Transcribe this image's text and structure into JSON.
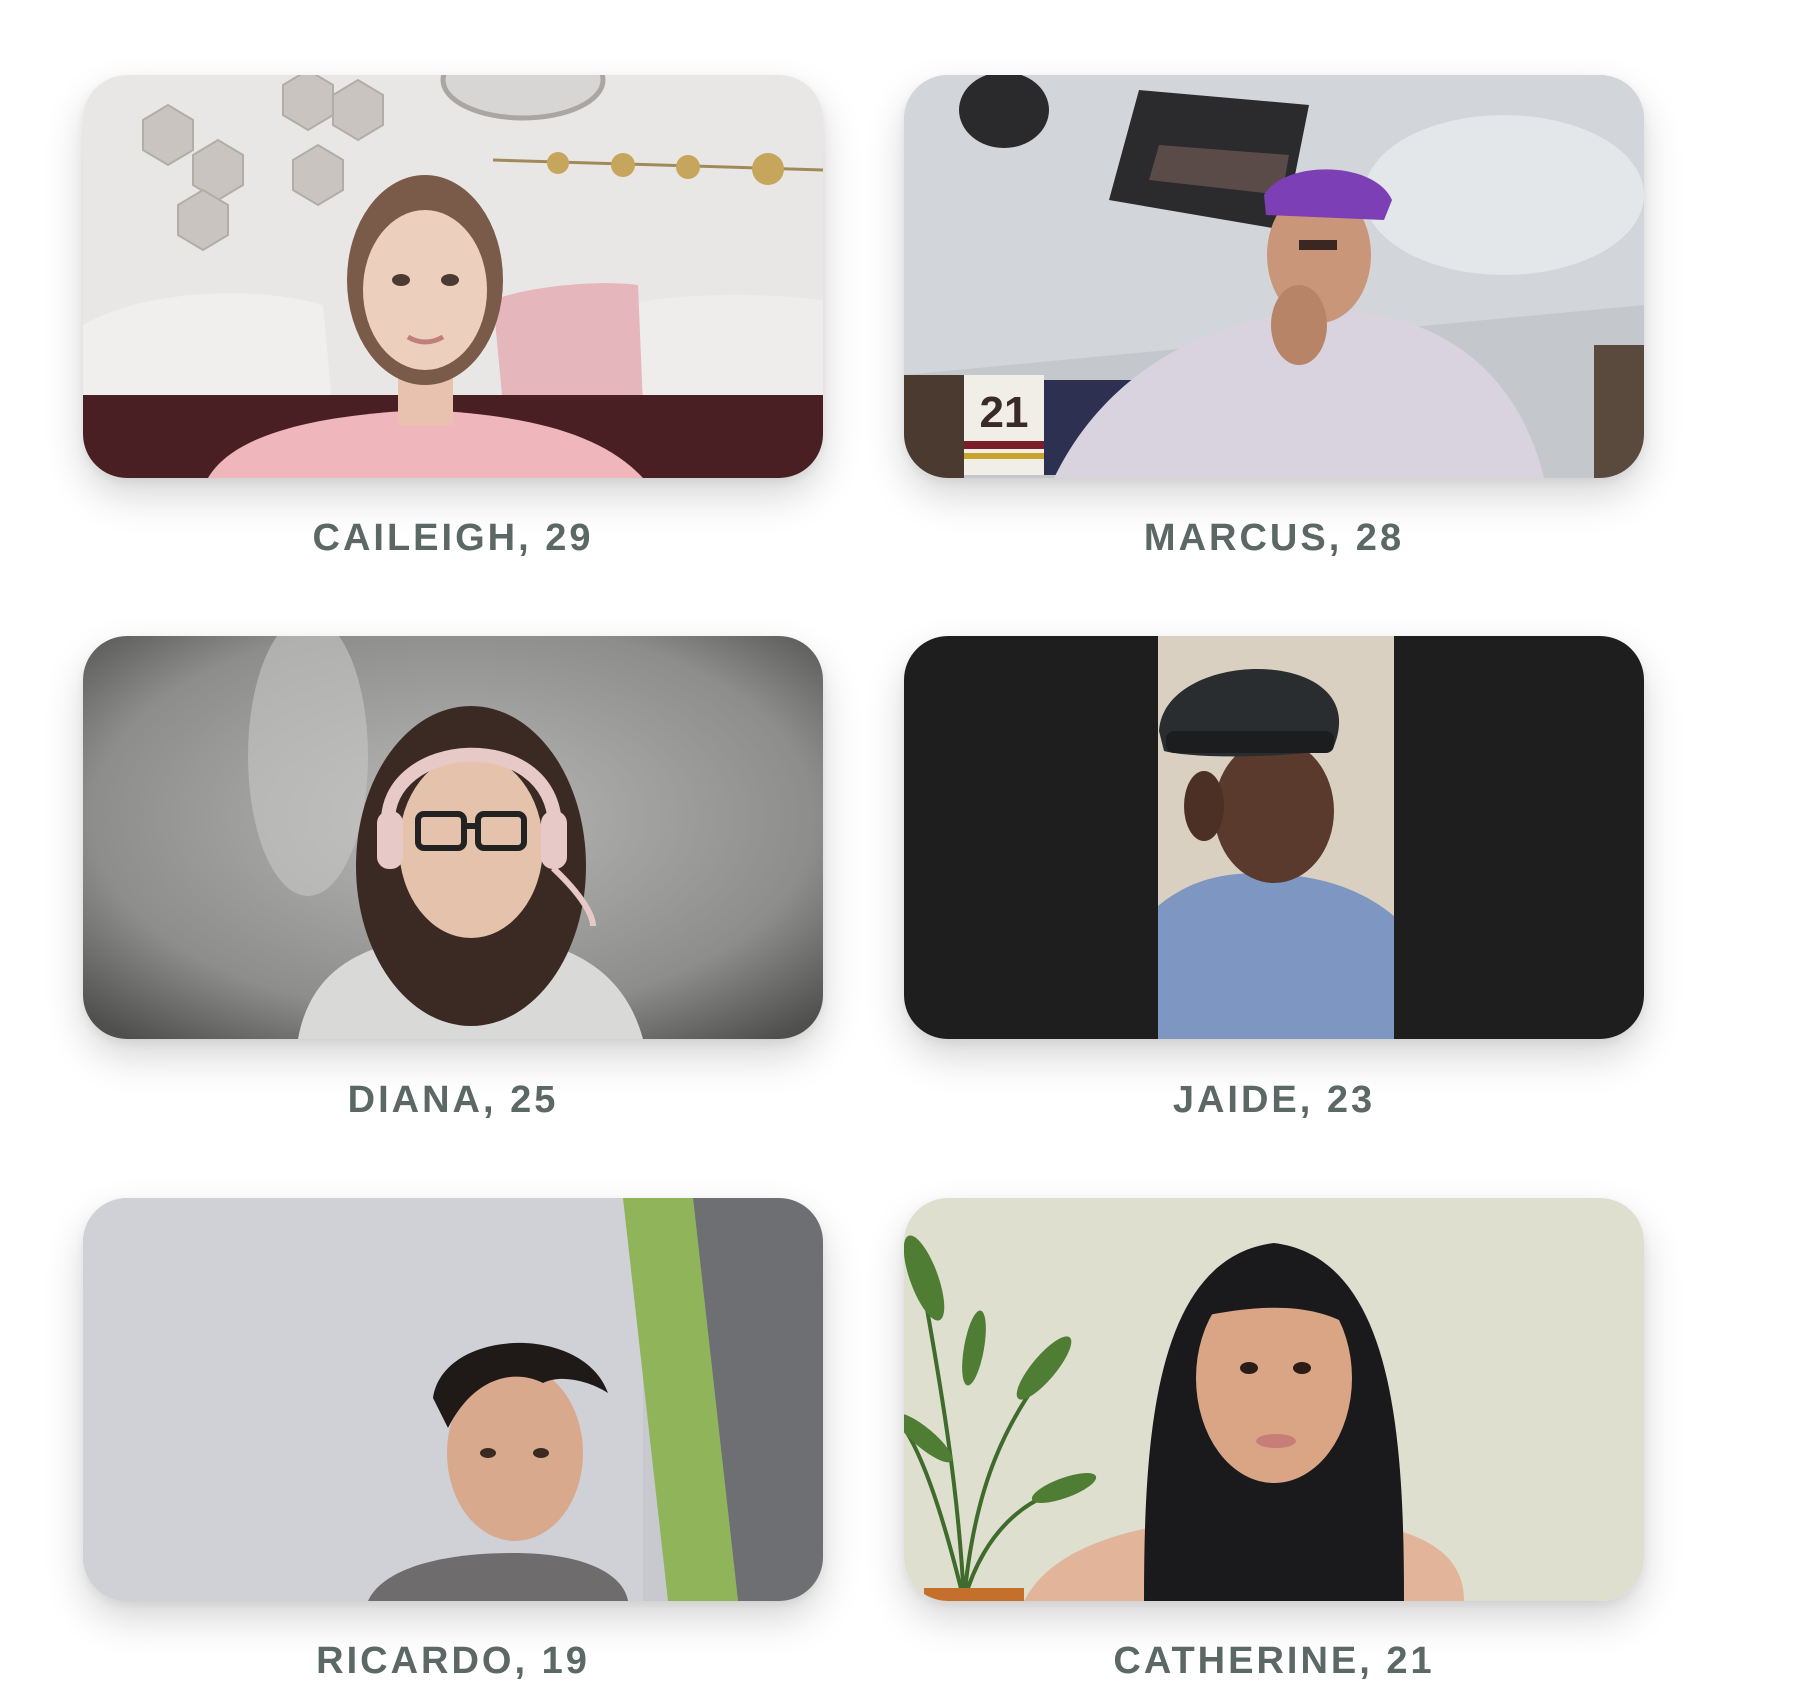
{
  "participants": [
    {
      "label": "CAILEIGH, 29"
    },
    {
      "label": "MARCUS, 28"
    },
    {
      "label": "DIANA, 25"
    },
    {
      "label": "JAIDE, 23"
    },
    {
      "label": "RICARDO, 19"
    },
    {
      "label": "CATHERINE, 21"
    }
  ],
  "jersey_number": "21",
  "colors": {
    "label_text": "#5b6866",
    "page_background": "#ffffff",
    "letterbox": "#1e1e1e"
  }
}
